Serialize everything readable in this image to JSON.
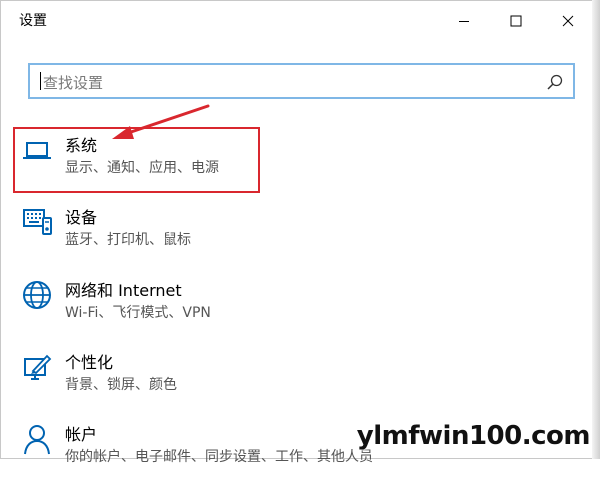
{
  "window": {
    "title": "设置",
    "controls": [
      "minimize-icon",
      "maximize-icon",
      "close-icon"
    ]
  },
  "search": {
    "placeholder": "查找设置",
    "icon": "search-icon"
  },
  "items": [
    {
      "title": "系统",
      "subtitle": "显示、通知、应用、电源",
      "icon": "laptop-icon",
      "highlighted": true
    },
    {
      "title": "设备",
      "subtitle": "蓝牙、打印机、鼠标",
      "icon": "keyboard-icon"
    },
    {
      "title": "网络和 Internet",
      "subtitle": "Wi-Fi、飞行模式、VPN",
      "icon": "globe-icon"
    },
    {
      "title": "个性化",
      "subtitle": "背景、锁屏、颜色",
      "icon": "paint-icon"
    },
    {
      "title": "帐户",
      "subtitle": "你的帐户、电子邮件、同步设置、工作、其他人员",
      "icon": "person-icon"
    }
  ],
  "colors": {
    "accent": "#0063b1",
    "search_border": "#7fb7e6",
    "annotation": "#d9272e"
  },
  "watermark": "ylmfwin100.com"
}
